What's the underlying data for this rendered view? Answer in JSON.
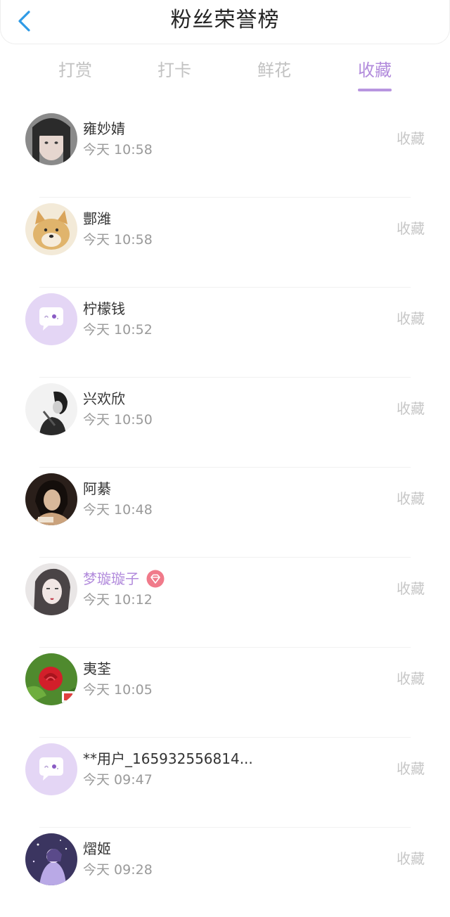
{
  "header": {
    "title": "粉丝荣誉榜",
    "accent_color": "#2f9ae6"
  },
  "tabs": [
    {
      "label": "打赏",
      "active": false
    },
    {
      "label": "打卡",
      "active": false
    },
    {
      "label": "鲜花",
      "active": false
    },
    {
      "label": "收藏",
      "active": true
    }
  ],
  "active_color": "#b28bdc",
  "list": [
    {
      "name": "雍妙婧",
      "time": "今天 10:58",
      "action": "收藏",
      "avatar": "photo-girl-avatar"
    },
    {
      "name": "酆潍",
      "time": "今天 10:58",
      "action": "收藏",
      "avatar": "shiba-dog-avatar"
    },
    {
      "name": "柠檬钱",
      "time": "今天 10:52",
      "action": "收藏",
      "avatar": "default-chat-avatar"
    },
    {
      "name": "兴欢欣",
      "time": "今天 10:50",
      "action": "收藏",
      "avatar": "bw-photo-avatar"
    },
    {
      "name": "阿綦",
      "time": "今天 10:48",
      "action": "收藏",
      "avatar": "dark-portrait-avatar"
    },
    {
      "name": "梦璇璇子",
      "time": "今天 10:12",
      "action": "收藏",
      "avatar": "sketch-girl-avatar",
      "vip": true,
      "badge": "diamond-badge-icon"
    },
    {
      "name": "夷荃",
      "time": "今天 10:05",
      "action": "收藏",
      "avatar": "red-rose-avatar"
    },
    {
      "name": "**用户_165932556814...",
      "time": "今天 09:47",
      "action": "收藏",
      "avatar": "default-chat-avatar"
    },
    {
      "name": "熠姬",
      "time": "今天 09:28",
      "action": "收藏",
      "avatar": "purple-night-avatar"
    }
  ]
}
